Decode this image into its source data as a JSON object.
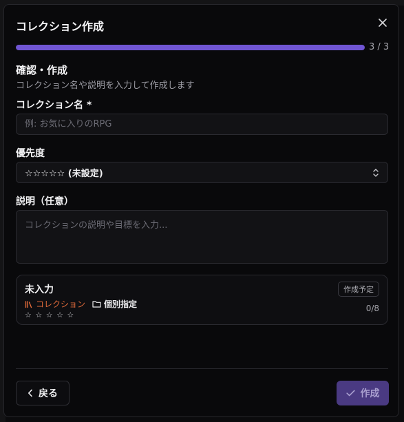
{
  "dialog": {
    "title": "コレクション作成",
    "progress": {
      "text": "3 / 3",
      "fraction": 1.0
    },
    "step": {
      "title": "確認・作成",
      "description": "コレクション名や説明を入力して作成します"
    },
    "name_field": {
      "label": "コレクション名 *",
      "placeholder": "例: お気に入りのRPG",
      "value": ""
    },
    "priority_field": {
      "label": "優先度",
      "value": "☆☆☆☆☆ (未設定)"
    },
    "description_field": {
      "label": "説明（任意）",
      "placeholder": "コレクションの説明や目標を入力...",
      "value": ""
    },
    "preview": {
      "name": "未入力",
      "badge": "作成予定",
      "type_label": "コレクション",
      "mode_label": "個別指定",
      "stars": "☆ ☆ ☆ ☆ ☆",
      "count": "0/8"
    },
    "buttons": {
      "back": "戻る",
      "create": "作成"
    }
  },
  "colors": {
    "accent": "#7055d3",
    "collection_type": "#e06a3a",
    "create_button_bg": "#4a3a82"
  },
  "icons": [
    "close-icon",
    "chevron-up-down-icon",
    "library-icon",
    "folder-icon",
    "chevron-left-icon",
    "check-icon"
  ]
}
